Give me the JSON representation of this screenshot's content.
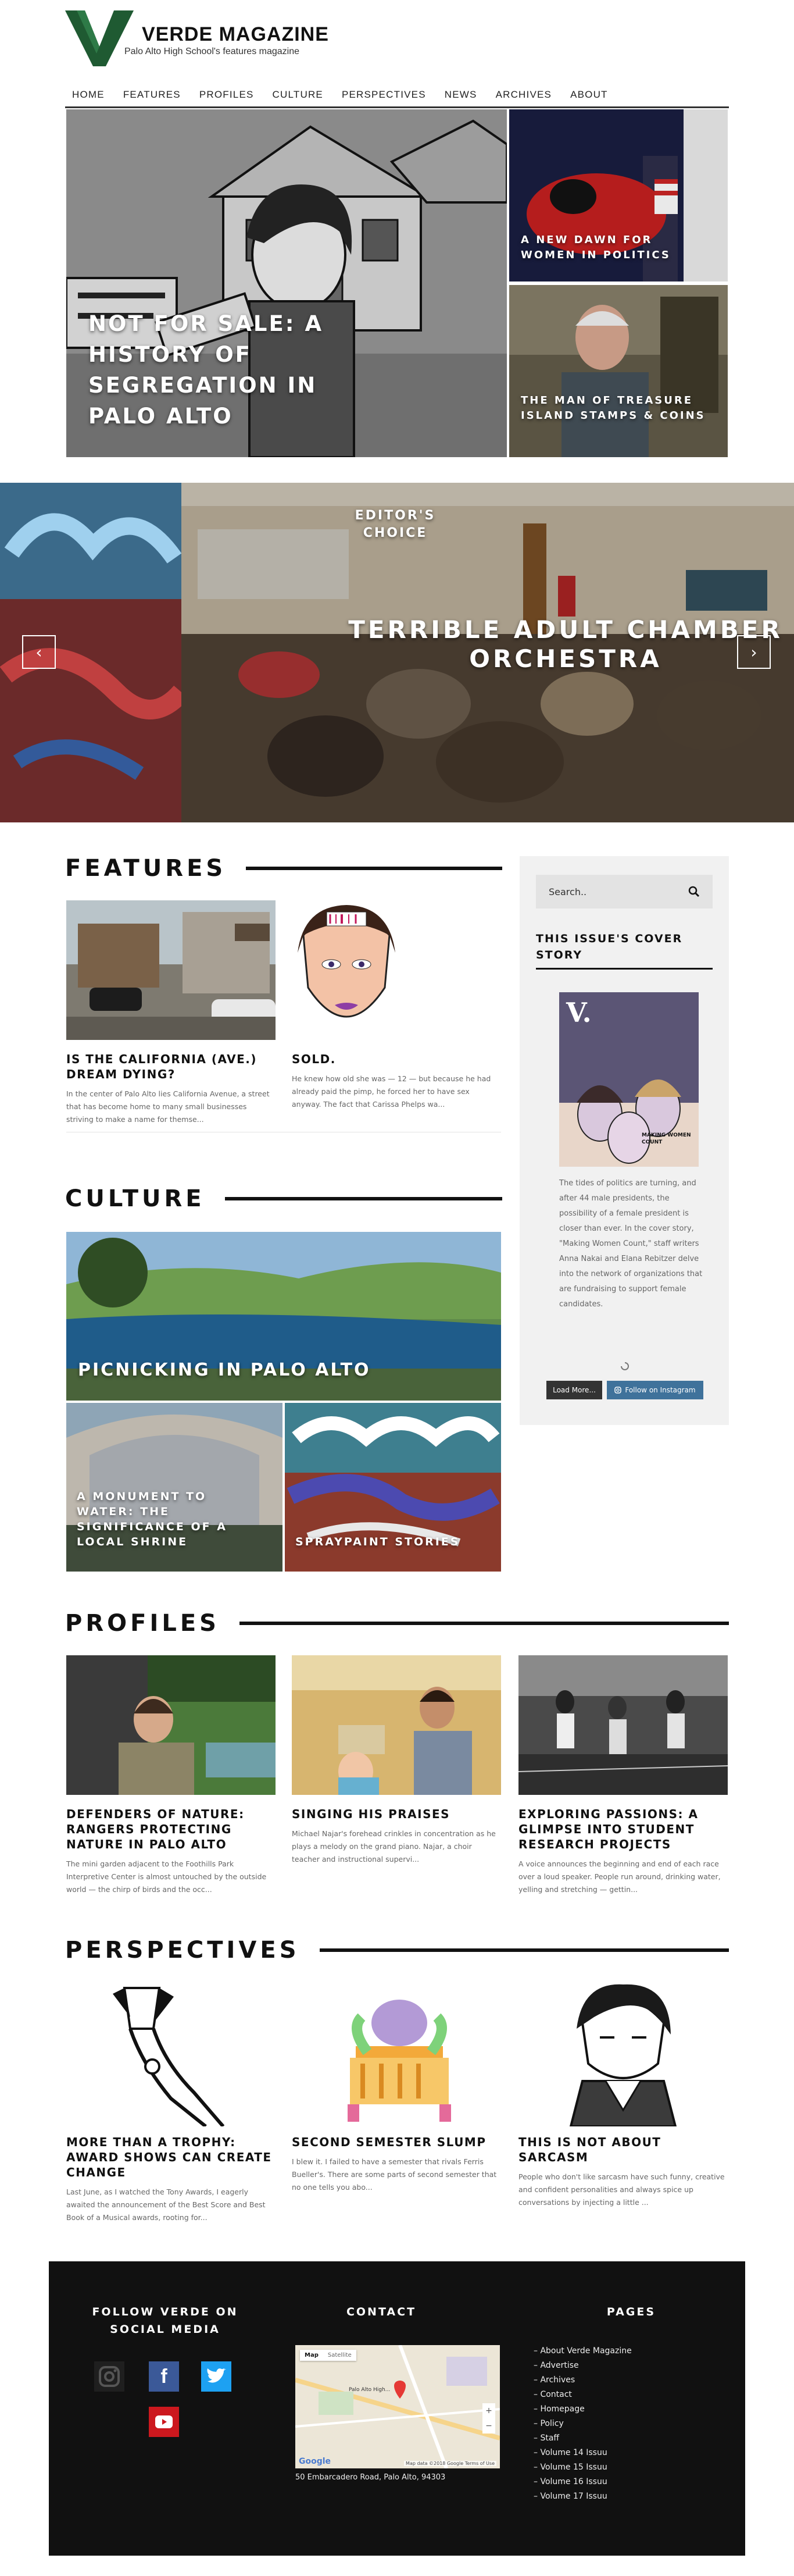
{
  "site": {
    "title": "VERDE MAGAZINE",
    "tagline": "Palo Alto High School's features magazine"
  },
  "nav": [
    "HOME",
    "FEATURES",
    "PROFILES",
    "CULTURE",
    "PERSPECTIVES",
    "NEWS",
    "ARCHIVES",
    "ABOUT"
  ],
  "hero": {
    "main_title": "NOT FOR SALE: A HISTORY OF SEGREGATION IN PALO ALTO",
    "side1_title": "A NEW DAWN FOR WOMEN IN POLITICS",
    "side2_title": "THE MAN OF TREASURE ISLAND STAMPS & COINS"
  },
  "slider": {
    "label": "EDITOR'S CHOICE",
    "title": "TERRIBLE ADULT CHAMBER ORCHESTRA",
    "prev_glyph": "‹",
    "next_glyph": "›"
  },
  "features": {
    "heading": "FEATURES",
    "items": [
      {
        "title": "IS THE CALIFORNIA (AVE.) DREAM DYING?",
        "excerpt": "In the center of Palo Alto lies California Avenue, a street that has become home to many small businesses striving to make a name for themse..."
      },
      {
        "title": "SOLD.",
        "excerpt": "He knew how old she was — 12 — but because he had already paid the pimp, he forced her to have sex anyway. The fact that Carissa Phelps wa..."
      }
    ]
  },
  "culture": {
    "heading": "CULTURE",
    "main_title": "PICNICKING IN PALO ALTO",
    "item1_title": "A MONUMENT TO WATER: THE SIGNIFICANCE OF A LOCAL SHRINE",
    "item2_title": "SPRAYPAINT STORIES"
  },
  "sidebar": {
    "search_placeholder": "Search..",
    "cover_heading": "THIS ISSUE'S COVER STORY",
    "cover_caption": "The tides of politics are turning, and after 44 male presidents, the possibility of a female president is closer than ever. In the cover story, \"Making Women Count,\" staff writers Anna Nakai and Elana Rebitzer delve into the network of organizations that are fundraising to support female candidates.",
    "cover_logo": "V.",
    "cover_headline": "MAKING WOMEN COUNT",
    "load_more": "Load More...",
    "follow_instagram": "Follow on Instagram"
  },
  "profiles": {
    "heading": "PROFILES",
    "items": [
      {
        "title": "DEFENDERS OF NATURE: RANGERS PROTECTING NATURE IN PALO ALTO",
        "excerpt": "The mini garden adjacent to the Foothills Park Interpretive Center is almost untouched by the outside world — the chirp of birds and the occ..."
      },
      {
        "title": "SINGING HIS PRAISES",
        "excerpt": "Michael Najar's forehead crinkles in concentration as he plays a melody on the grand piano. Najar, a choir teacher and instructional supervi..."
      },
      {
        "title": "EXPLORING PASSIONS: A GLIMPSE INTO STUDENT RESEARCH PROJECTS",
        "excerpt": "A voice announces the beginning and end of each race over a loud speaker. People run around, drinking water, yelling and stretching — gettin..."
      }
    ]
  },
  "perspectives": {
    "heading": "PERSPECTIVES",
    "items": [
      {
        "title": "MORE THAN A TROPHY: AWARD SHOWS CAN CREATE CHANGE",
        "excerpt": "Last June, as I watched the Tony Awards, I eagerly awaited the announcement of the Best Score and Best Book of a Musical awards, rooting for..."
      },
      {
        "title": "SECOND SEMESTER SLUMP",
        "excerpt": "I blew it. I failed to have a semester that rivals Ferris Bueller's. There are some parts of second semester that no one tells you abo..."
      },
      {
        "title": "THIS IS NOT ABOUT SARCASM",
        "excerpt": "People who don't like sarcasm have such funny, creative and confident personalities and always spice up conversations by injecting a little ..."
      }
    ]
  },
  "footer": {
    "social_heading": "FOLLOW VERDE ON SOCIAL MEDIA",
    "social": [
      "instagram-icon",
      "facebook-icon",
      "twitter-icon",
      "youtube-icon"
    ],
    "contact_heading": "CONTACT",
    "map_tab_map": "Map",
    "map_tab_sat": "Satellite",
    "map_place": "Palo Alto High...",
    "map_google": "Google",
    "map_meta": "Map data ©2018 Google  Terms of Use",
    "address": "50 Embarcadero Road, Palo Alto, 94303",
    "pages_heading": "PAGES",
    "pages": [
      "About Verde Magazine",
      "Advertise",
      "Archives",
      "Contact",
      "Homepage",
      "Policy",
      "Staff",
      "Volume 14 Issuu",
      "Volume 15 Issuu",
      "Volume 16 Issuu",
      "Volume 17 Issuu"
    ]
  },
  "colors": {
    "brand_green": "#1f5a32",
    "nav_rule": "#333333",
    "footer_bg": "#111111",
    "facebook": "#3b5998",
    "twitter": "#1da1f2",
    "youtube": "#cc181e",
    "instagram_button": "#3f729b"
  }
}
